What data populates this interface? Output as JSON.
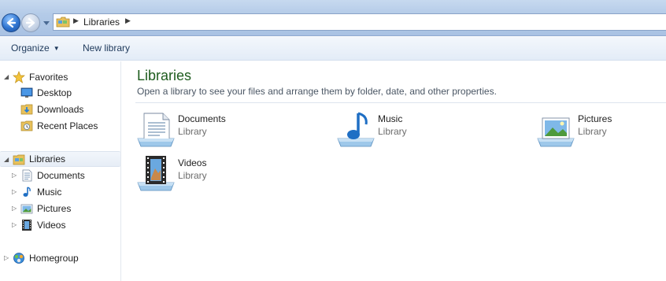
{
  "address_bar": {
    "path": "Libraries"
  },
  "toolbar": {
    "organize_label": "Organize",
    "new_library_label": "New library"
  },
  "sidebar": {
    "favorites": {
      "label": "Favorites",
      "items": [
        {
          "label": "Desktop",
          "icon": "desktop-icon"
        },
        {
          "label": "Downloads",
          "icon": "downloads-folder-icon"
        },
        {
          "label": "Recent Places",
          "icon": "recent-places-icon"
        }
      ]
    },
    "libraries": {
      "label": "Libraries",
      "items": [
        {
          "label": "Documents",
          "icon": "documents-icon"
        },
        {
          "label": "Music",
          "icon": "music-icon"
        },
        {
          "label": "Pictures",
          "icon": "pictures-icon"
        },
        {
          "label": "Videos",
          "icon": "videos-icon"
        }
      ]
    },
    "homegroup": {
      "label": "Homegroup"
    }
  },
  "content": {
    "title": "Libraries",
    "subtitle": "Open a library to see your files and arrange them by folder, date, and other properties.",
    "libraries": [
      {
        "name": "Documents",
        "type": "Library",
        "icon": "documents-library-icon"
      },
      {
        "name": "Music",
        "type": "Library",
        "icon": "music-library-icon"
      },
      {
        "name": "Pictures",
        "type": "Library",
        "icon": "pictures-library-icon"
      },
      {
        "name": "Videos",
        "type": "Library",
        "icon": "videos-library-icon"
      }
    ]
  },
  "colors": {
    "title_green": "#1e5c1e",
    "toolbar_text": "#1e395b",
    "address_bar_blue": "#b4cbe8",
    "selection_bg": "#e6edf6"
  }
}
